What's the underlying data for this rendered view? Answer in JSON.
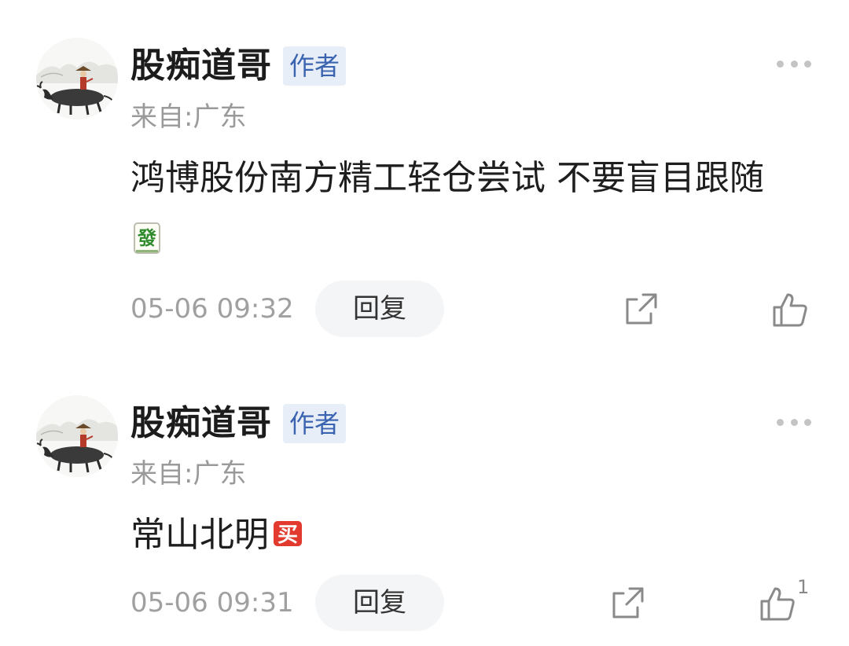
{
  "comments": [
    {
      "author": "股痴道哥",
      "badge": "作者",
      "location": "来自:广东",
      "content": "鸿博股份南方精工轻仓尝试 不要盲目跟随",
      "emoji": "mahjong-fa-icon",
      "timestamp": "05-06 09:32",
      "reply_label": "回复",
      "like_count": ""
    },
    {
      "author": "股痴道哥",
      "badge": "作者",
      "location": "来自:广东",
      "content": "常山北明",
      "emoji": "buy-sticker-icon",
      "emoji_text": "买",
      "timestamp": "05-06 09:31",
      "reply_label": "回复",
      "like_count": "1"
    }
  ],
  "colors": {
    "badge_bg": "#e8eef8",
    "badge_text": "#3b64b0",
    "muted_text": "#a0a0a0",
    "reply_bg": "#f4f5f7",
    "icon_gray": "#8a8a8a"
  }
}
